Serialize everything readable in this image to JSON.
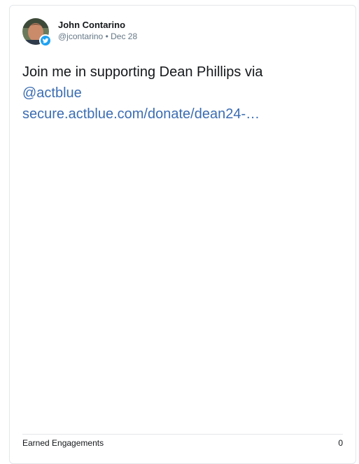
{
  "author": {
    "display_name": "John Contarino",
    "handle": "@jcontarino",
    "separator": "•",
    "date": "Dec 28",
    "avatar_icon": "user-avatar",
    "platform_icon": "twitter-bird-icon",
    "platform_color": "#1da1f2"
  },
  "tweet": {
    "text": "Join me in supporting Dean Phillips via",
    "mention": "@actblue",
    "url": "secure.actblue.com/donate/dean24-…",
    "link_color": "#3b6db3"
  },
  "footer": {
    "label": "Earned Engagements",
    "value": "0"
  }
}
